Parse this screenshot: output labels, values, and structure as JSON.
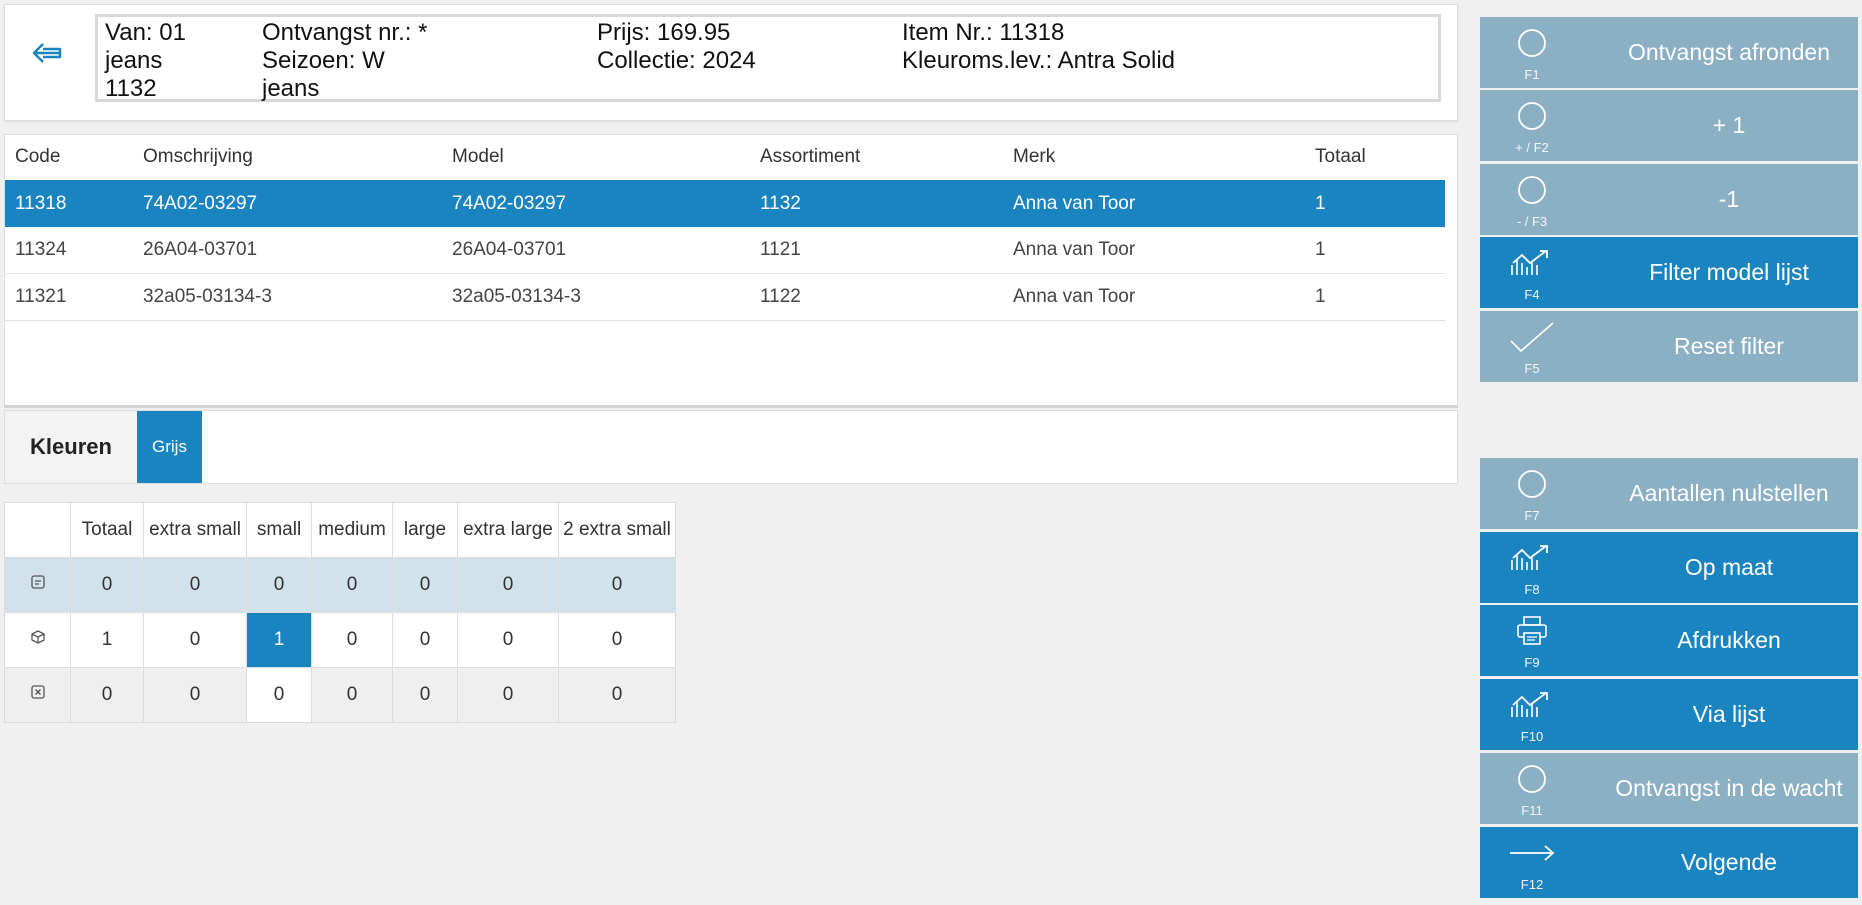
{
  "header": {
    "col1": [
      "Van: 01",
      "jeans",
      "1132"
    ],
    "col2": [
      "Ontvangst nr.: *",
      "Seizoen: W",
      "jeans"
    ],
    "col3": [
      "Prijs: 169.95",
      "Collectie: 2024"
    ],
    "col4": [
      "Item Nr.: 11318",
      "Kleuroms.lev.: Antra Solid"
    ]
  },
  "items_table": {
    "columns": [
      "Code",
      "Omschrijving",
      "Model",
      "Assortiment",
      "Merk",
      "Totaal"
    ],
    "rows": [
      [
        "11318",
        "74A02-03297",
        "74A02-03297",
        "1132",
        "Anna van Toor",
        "1"
      ],
      [
        "11324",
        "26A04-03701",
        "26A04-03701",
        "1121",
        "Anna van Toor",
        "1"
      ],
      [
        "11321",
        "32a05-03134-3",
        "32a05-03134-3",
        "1122",
        "Anna van Toor",
        "1"
      ]
    ],
    "selected_row": 0
  },
  "colors": {
    "label": "Kleuren",
    "tabs": [
      "Grijs"
    ]
  },
  "size_grid": {
    "columns": [
      "Totaal",
      "extra small",
      "small",
      "medium",
      "large",
      "extra large",
      "2 extra small"
    ],
    "rows": [
      {
        "icon": "order-icon",
        "values": [
          "0",
          "0",
          "0",
          "0",
          "0",
          "0",
          "0"
        ]
      },
      {
        "icon": "box-icon",
        "values": [
          "1",
          "0",
          "1",
          "0",
          "0",
          "0",
          "0"
        ]
      },
      {
        "icon": "cancel-icon",
        "values": [
          "0",
          "0",
          "0",
          "0",
          "0",
          "0",
          "0"
        ]
      }
    ]
  },
  "buttons": [
    {
      "key": "F1",
      "label": "Ontvangst afronden",
      "icon": "circle-icon",
      "style": "light"
    },
    {
      "key": "+ / F2",
      "label": "+ 1",
      "icon": "circle-icon",
      "style": "light"
    },
    {
      "key": "- / F3",
      "label": "-1",
      "icon": "circle-icon",
      "style": "light"
    },
    {
      "key": "F4",
      "label": "Filter model lijst",
      "icon": "chart-arrow-icon",
      "style": "dark"
    },
    {
      "key": "F5",
      "label": "Reset filter",
      "icon": "checkmark-icon",
      "style": "light"
    },
    {
      "key": "F7",
      "label": "Aantallen nulstellen",
      "icon": "circle-icon",
      "style": "light"
    },
    {
      "key": "F8",
      "label": "Op maat",
      "icon": "chart-arrow-icon",
      "style": "dark"
    },
    {
      "key": "F9",
      "label": "Afdrukken",
      "icon": "printer-icon",
      "style": "dark"
    },
    {
      "key": "F10",
      "label": "Via lijst",
      "icon": "chart-arrow-icon",
      "style": "dark"
    },
    {
      "key": "F11",
      "label": "Ontvangst in de wacht",
      "icon": "circle-icon",
      "style": "light"
    },
    {
      "key": "F12",
      "label": "Volgende",
      "icon": "arrow-right-icon",
      "style": "dark"
    }
  ],
  "colors_palette": {
    "accent": "#1a84c1",
    "button_light": "#8bafc3",
    "background": "#f0f0f0"
  }
}
